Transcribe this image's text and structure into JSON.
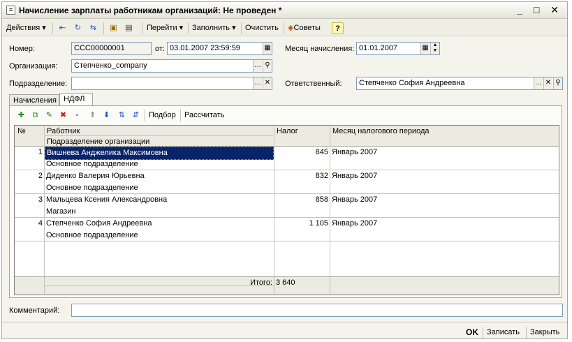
{
  "window": {
    "title": "Начисление зарплаты работникам организаций: Не проведен *",
    "controls": "_ □ ✕"
  },
  "toolbar": {
    "actions_label": "Действия",
    "goto_label": "Перейти",
    "fill_label": "Заполнить",
    "clear_label": "Очистить",
    "tips_label": "Советы",
    "help_label": "?"
  },
  "form": {
    "number_label": "Номер:",
    "number_value": "ССС00000001",
    "from_label": "от:",
    "date_value": "03.01.2007 23:59:59",
    "month_label": "Месяц начисления:",
    "month_value": "01.01.2007",
    "org_label": "Организация:",
    "org_value": "Степченко_company",
    "dept_label": "Подразделение:",
    "dept_value": "",
    "responsible_label": "Ответственный:",
    "responsible_value": "Степченко София Андреевна",
    "comment_label": "Комментарий:",
    "comment_value": ""
  },
  "tabs": [
    {
      "label": "Начисления"
    },
    {
      "label": "НДФЛ"
    }
  ],
  "panel_toolbar": {
    "select_label": "Подбор",
    "calc_label": "Рассчитать"
  },
  "table": {
    "headers": {
      "num": "№",
      "employee": "Работник",
      "department": "Подразделение организации",
      "tax": "Налог",
      "month": "Месяц налогового периода"
    },
    "rows": [
      {
        "num": "1",
        "employee": "Вишнева Анджелика Максимовна",
        "department": "Основное подразделение",
        "tax": "845",
        "month": "Январь 2007"
      },
      {
        "num": "2",
        "employee": "Диденко Валерия Юрьевна",
        "department": "Основное подразделение",
        "tax": "832",
        "month": "Январь 2007"
      },
      {
        "num": "3",
        "employee": "Мальцева Ксения Александровна",
        "department": "Магазин",
        "tax": "858",
        "month": "Январь 2007"
      },
      {
        "num": "4",
        "employee": "Степченко София Андреевна",
        "department": "Основное подразделение",
        "tax": "1 105",
        "month": "Январь 2007"
      }
    ],
    "total_label": "Итого:",
    "total_value": "3 640"
  },
  "buttons": {
    "ok": "OK",
    "save": "Записать",
    "close": "Закрыть"
  }
}
